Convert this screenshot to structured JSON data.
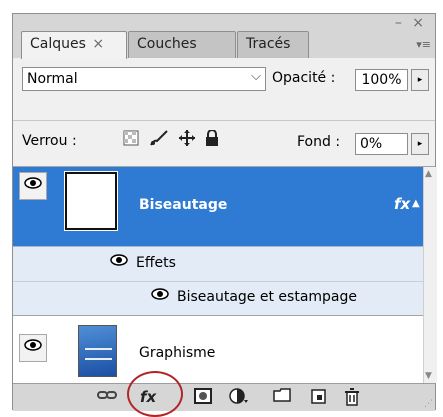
{
  "window": {
    "controls": "– ×"
  },
  "tabs": [
    {
      "label": "Calques",
      "close": "×"
    },
    {
      "label": "Couches"
    },
    {
      "label": "Tracés"
    }
  ],
  "panel_menu": "▾≡",
  "blend_mode": {
    "value": "Normal",
    "arrow": "⌵"
  },
  "opacity": {
    "label": "Opacité :",
    "value": "100%",
    "arrow": "▸"
  },
  "lock": {
    "label": "Verrou :",
    "icons": [
      "transparency-lock-icon",
      "brush-lock-icon",
      "move-lock-icon",
      "padlock-icon"
    ]
  },
  "fill": {
    "label": "Fond :",
    "value": "0%",
    "arrow": "▸"
  },
  "layers": [
    {
      "name": "Biseautage",
      "selected": true,
      "fx": "fx",
      "effects_label": "Effets",
      "effects": [
        "Biseautage et estampage"
      ]
    },
    {
      "name": "Graphisme",
      "selected": false
    }
  ],
  "bottom_bar": {
    "icons": [
      "link-layers-icon",
      "add-layer-style-icon",
      "add-mask-icon",
      "adjustment-layer-icon",
      "new-group-icon",
      "new-layer-icon",
      "delete-layer-icon"
    ],
    "fx_label": "fx"
  },
  "colors": {
    "selection": "#2f7ad3",
    "effects_bg": "#e2ebf6",
    "panel_bg": "#d6d6d6",
    "annotation_circle": "#b02626"
  }
}
